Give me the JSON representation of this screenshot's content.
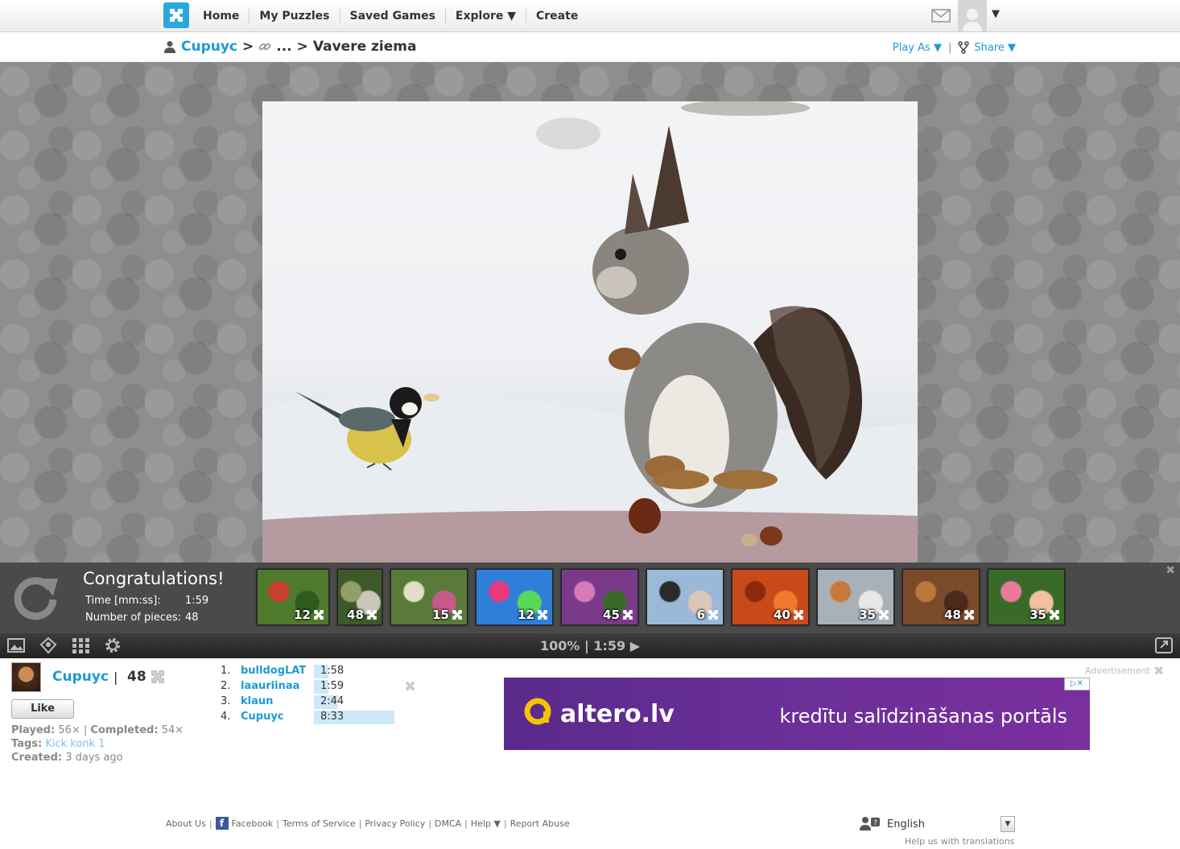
{
  "nav": {
    "items": [
      "Home",
      "My Puzzles",
      "Saved Games",
      "Explore ▼",
      "Create"
    ],
    "avatar_caret": "▼"
  },
  "breadcrumb": {
    "user": "Cupuyc",
    "sep1": ">",
    "ellipsis": "...",
    "sep2": ">",
    "title": "Vavere ziema",
    "play_as": "Play As ▼",
    "pipe": "|",
    "share": "Share ▼"
  },
  "congrats": {
    "title": "Congratulations!",
    "time_label": "Time [mm:ss]:",
    "time_value": "1:59",
    "pieces_label": "Number of pieces:",
    "pieces_value": "48",
    "close": "✖",
    "thumbs": [
      {
        "count": "12",
        "colors": [
          "#4f7a2e",
          "#c8402a",
          "#2f5a1e"
        ]
      },
      {
        "count": "48",
        "colors": [
          "#3f5a2a",
          "#8fa06a",
          "#c9c7b8"
        ]
      },
      {
        "count": "15",
        "colors": [
          "#5a7a3a",
          "#e2dcc8",
          "#c85a8a"
        ]
      },
      {
        "count": "12",
        "colors": [
          "#2f7fd8",
          "#e83a7a",
          "#5ad85a"
        ]
      },
      {
        "count": "45",
        "colors": [
          "#7a3a8a",
          "#d87ab8",
          "#3a6a2a"
        ]
      },
      {
        "count": "6",
        "colors": [
          "#9ab8d8",
          "#2a2a2a",
          "#d8c8b8"
        ]
      },
      {
        "count": "40",
        "colors": [
          "#c84a1a",
          "#8a2a0a",
          "#f07a2a"
        ]
      },
      {
        "count": "35",
        "colors": [
          "#a8b0b8",
          "#c8783a",
          "#e8e8e8"
        ]
      },
      {
        "count": "48",
        "colors": [
          "#7a4a2a",
          "#b8783a",
          "#4a2a1a"
        ]
      },
      {
        "count": "35",
        "colors": [
          "#3a6a2a",
          "#e87a9a",
          "#f0c0a0"
        ]
      }
    ]
  },
  "toolbar": {
    "status": "100% | 1:59 ▶"
  },
  "info": {
    "name": "Cupuyc",
    "pipe": "|",
    "count": "48",
    "like": "Like",
    "played_label": "Played:",
    "played_value": "56×",
    "completed_label": "Completed:",
    "completed_value": "54×",
    "tags_label": "Tags:",
    "tags_value": "Kick konk 1",
    "created_label": "Created:",
    "created_value": "3 days ago"
  },
  "leaderboard": [
    {
      "rank": "1.",
      "name": "bulldogLAT",
      "time": "1:58",
      "bar": 0.18
    },
    {
      "rank": "2.",
      "name": "laauriinaa",
      "time": "1:59",
      "bar": 0.18
    },
    {
      "rank": "3.",
      "name": "klaun",
      "time": "2:44",
      "bar": 0.3
    },
    {
      "rank": "4.",
      "name": "Cupuyc",
      "time": "8:33",
      "bar": 1.0
    }
  ],
  "leaderboard_close": "✖",
  "ad": {
    "label": "Advertisement",
    "close": "✖",
    "brand": "altero.lv",
    "text": "kredītu salīdzināšanas portāls",
    "choice": "▷✕"
  },
  "footer": {
    "about": "About Us",
    "facebook": "Facebook",
    "terms": "Terms of Service",
    "privacy": "Privacy Policy",
    "dmca": "DMCA",
    "help": "Help ▼",
    "report": "Report Abuse",
    "sep": "|",
    "language": "English",
    "lang_caret": "▼",
    "help_translate": "Help us with translations"
  }
}
